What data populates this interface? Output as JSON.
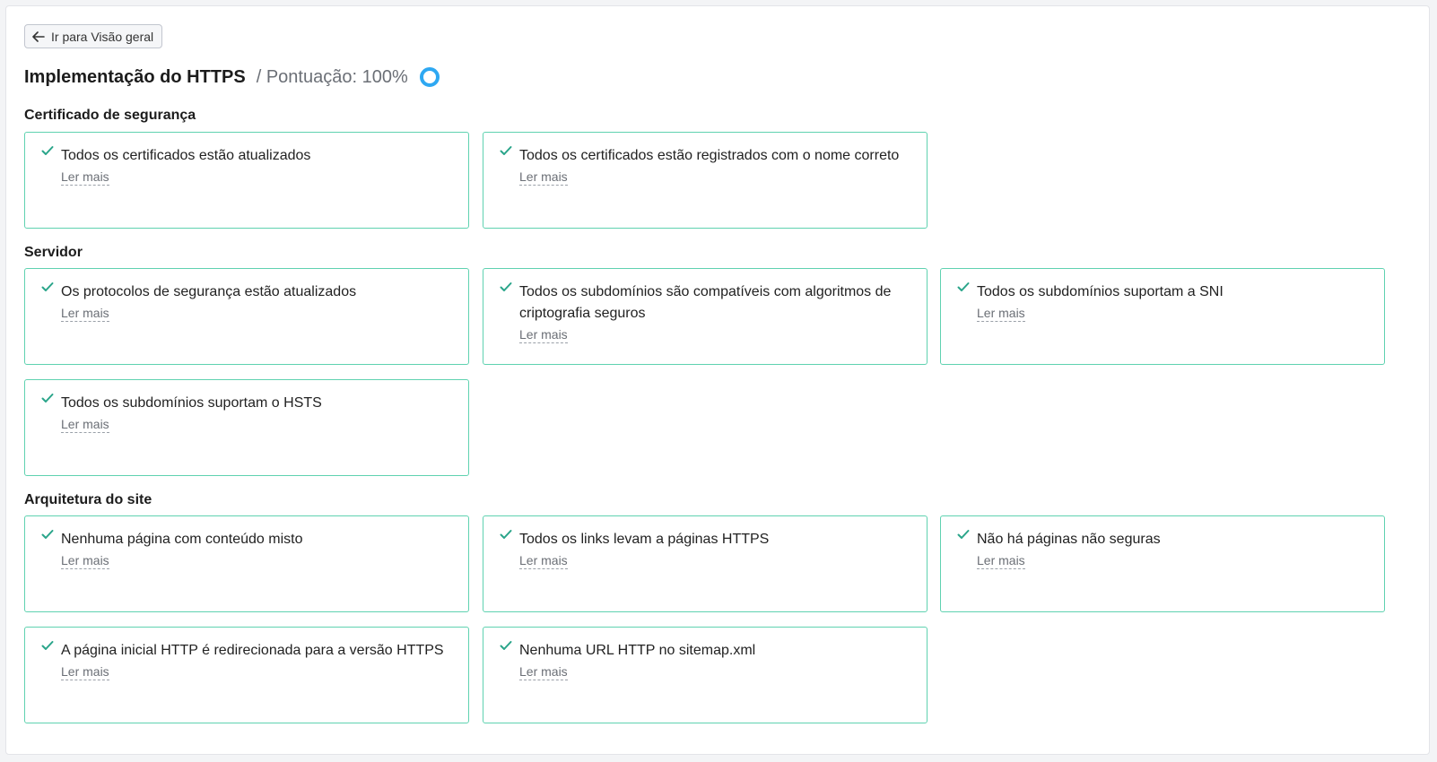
{
  "back_button": {
    "label": "Ir para Visão geral"
  },
  "header": {
    "title": "Implementação do HTTPS",
    "score": "/ Pontuação: 100%"
  },
  "read_more_label": "Ler mais",
  "sections": [
    {
      "title": "Certificado de segurança",
      "checks": [
        "Todos os certificados estão atualizados",
        "Todos os certificados estão registrados com o nome correto"
      ]
    },
    {
      "title": "Servidor",
      "checks": [
        "Os protocolos de segurança estão atualizados",
        "Todos os subdomínios são compatíveis com algoritmos de criptografia seguros",
        "Todos os subdomínios suportam a SNI",
        "Todos os subdomínios suportam o HSTS"
      ]
    },
    {
      "title": "Arquitetura do site",
      "checks": [
        "Nenhuma página com conteúdo misto",
        "Todos os links levam a páginas HTTPS",
        "Não há páginas não seguras",
        "A página inicial HTTP é redirecionada para a versão HTTPS",
        "Nenhuma URL HTTP no sitemap.xml"
      ]
    }
  ],
  "colors": {
    "card_border": "#5fd2b0",
    "check": "#2aa58a",
    "score_ring": "#2ea8f2"
  }
}
